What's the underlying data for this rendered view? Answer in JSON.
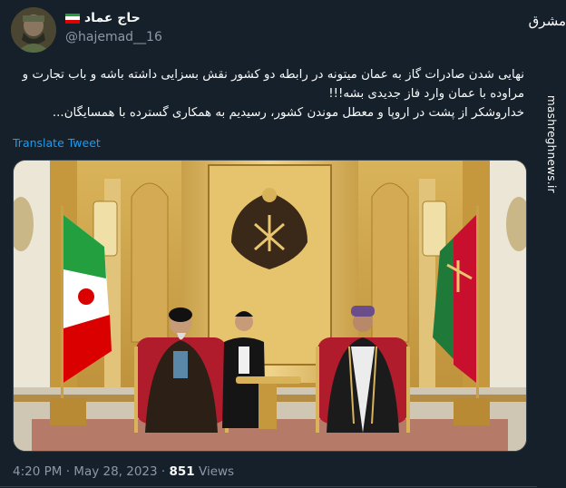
{
  "author": {
    "display_name": "حاج عماد",
    "handle": "@hajemad__16"
  },
  "tweet": {
    "lines": [
      "نهایی شدن صادرات گاز به عمان میتونه در رابطه دو کشور نقش بسزایی داشته باشه و باب تجارت و",
      "مراوده با عمان وارد فاز جدیدی بشه!!!",
      "خداروشکر از پشت در اروپا و معطل موندن کشور، رسیدیم به همکاری گسترده با همسایگان..."
    ],
    "translate_label": "Translate Tweet"
  },
  "meta": {
    "time": "4:20 PM",
    "separator1": "·",
    "date": "May 28, 2023",
    "separator2": "·",
    "views_count": "851",
    "views_label": "Views"
  },
  "watermark": {
    "logo_text": "مشرق",
    "url": "mashreghnews.ir"
  },
  "colors": {
    "background": "#15202b",
    "link": "#1d9bf0",
    "secondary_text": "#8b98a5"
  }
}
